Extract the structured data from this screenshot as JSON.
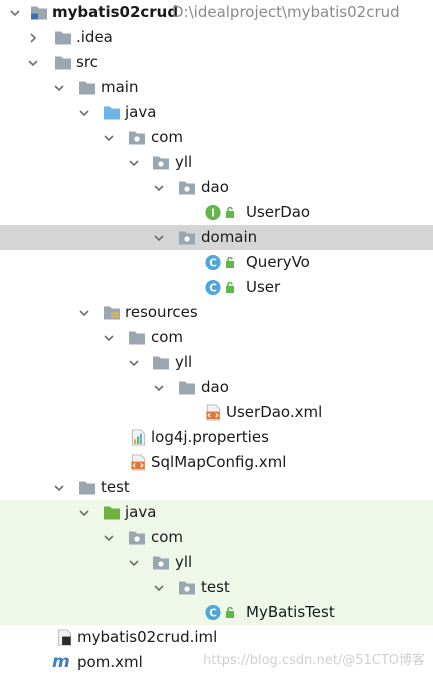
{
  "tree": {
    "project_name": "mybatis02crud",
    "project_path": "D:\\idealproject\\mybatis02crud",
    "idea": ".idea",
    "src": "src",
    "main": "main",
    "java": "java",
    "com": "com",
    "yll": "yll",
    "dao": "dao",
    "userdao": "UserDao",
    "domain": "domain",
    "queryvo": "QueryVo",
    "user": "User",
    "resources": "resources",
    "res_com": "com",
    "res_yll": "yll",
    "res_dao": "dao",
    "userdao_xml": "UserDao.xml",
    "log4j": "log4j.properties",
    "sqlmapconfig": "SqlMapConfig.xml",
    "test": "test",
    "test_java": "java",
    "test_com": "com",
    "test_yll": "yll",
    "test_pkg": "test",
    "mybatistest": "MyBatisTest",
    "iml": "mybatis02crud.iml",
    "pom": "pom.xml"
  },
  "watermark": "https://blog.csdn.net/@51CTO博客",
  "colors": {
    "selection": "#d5d5d5",
    "test_bg": "#eef7e8",
    "folder": "#9aa7b0",
    "java_src": "#6fb4e6",
    "test_src": "#6cb33e",
    "class_icon": "#4da6d9",
    "interface_icon": "#5fb94a",
    "xml_icon": "#e0783a",
    "maven_m": "#3c7ec7"
  }
}
